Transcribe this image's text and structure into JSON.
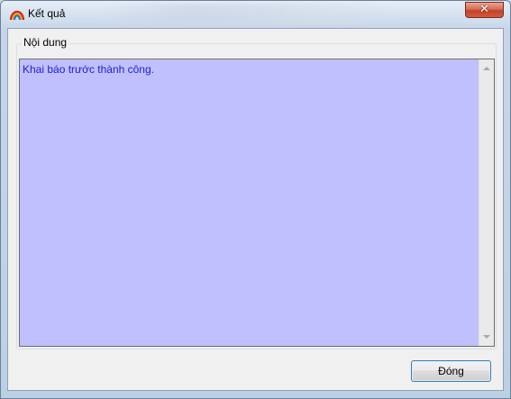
{
  "window": {
    "title": "Kết quả",
    "app_icon": "rainbow-icon",
    "close_glyph": "✕"
  },
  "group": {
    "label": "Nội dung"
  },
  "content": {
    "text": "Khai báo trước thành công.",
    "background_color": "#c0c0ff",
    "text_color": "#1c1cd8"
  },
  "actions": {
    "close_label": "Đóng"
  }
}
